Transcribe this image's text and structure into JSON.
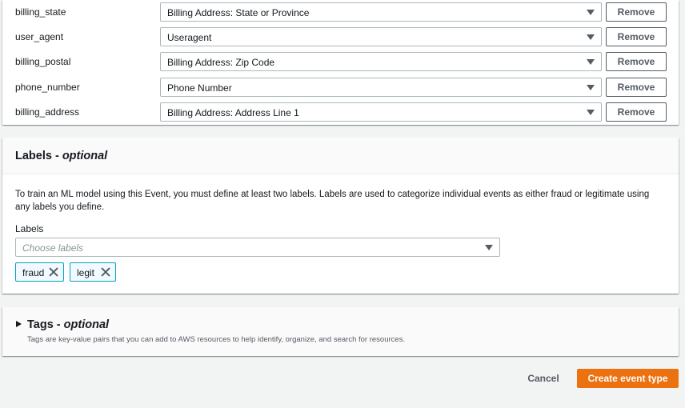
{
  "variable_mappings": [
    {
      "name": "billing_state",
      "selected": "Billing Address: State or Province",
      "action": "Remove"
    },
    {
      "name": "user_agent",
      "selected": "Useragent",
      "action": "Remove"
    },
    {
      "name": "billing_postal",
      "selected": "Billing Address: Zip Code",
      "action": "Remove"
    },
    {
      "name": "phone_number",
      "selected": "Phone Number",
      "action": "Remove"
    },
    {
      "name": "billing_address",
      "selected": "Billing Address: Address Line 1",
      "action": "Remove"
    }
  ],
  "labels_section": {
    "title": "Labels - ",
    "title_optional": "optional",
    "description": "To train an ML model using this Event, you must define at least two labels. Labels are used to categorize individual events as either fraud or legitimate using any labels you define.",
    "field_label": "Labels",
    "placeholder": "Choose labels",
    "tokens": [
      "fraud",
      "legit"
    ]
  },
  "tags_section": {
    "title": "Tags - ",
    "title_optional": "optional",
    "description": "Tags are key-value pairs that you can add to AWS resources to help identify, organize, and search for resources."
  },
  "footer": {
    "cancel_label": "Cancel",
    "create_label": "Create event type"
  },
  "colors": {
    "primary_button": "#ec7211",
    "token_border": "#00a1c9",
    "page_background": "#f2f3f3"
  },
  "icons": [
    "caret-down-icon",
    "close-icon",
    "expand-triangle-icon"
  ]
}
